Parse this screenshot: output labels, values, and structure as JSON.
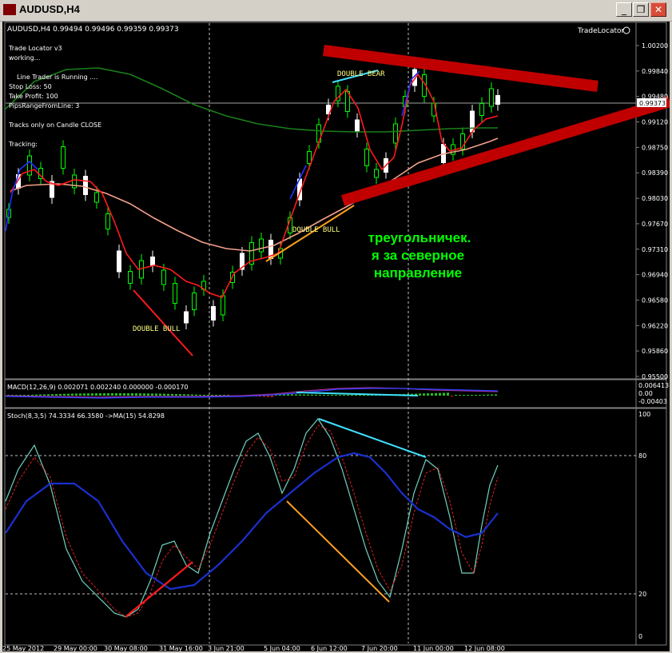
{
  "window": {
    "title": "AUDUSD,H4",
    "minimize": "_",
    "restore": "❐",
    "close": "✕"
  },
  "main_panel": {
    "header": "AUDUSD,H4  0.99494 0.99496 0.99359 0.99373",
    "trade_locator_label": "TradeLocator",
    "ea_info": [
      "Trade Locator v3",
      "working...",
      "",
      "Line Trader is Running ....",
      "Stop Loss: 50",
      "Take Profit: 100",
      "PipsRangeFromLine: 3",
      "",
      "Tracks only on Candle CLOSE",
      "",
      "Tracking:"
    ],
    "price_labels": [
      "1.00200",
      "0.99840",
      "0.99480",
      "0.99120",
      "0.98750",
      "0.98390",
      "0.98030",
      "0.97670",
      "0.97310",
      "0.96940",
      "0.96580",
      "0.96220",
      "0.95860",
      "0.95500"
    ],
    "current_price": "0.99373",
    "pattern_labels": {
      "double_bull_left": "DOUBLE BULL",
      "double_bull_mid": "DOUBLE BULL",
      "double_bear": "DOUBLE BEAR"
    },
    "annotation": [
      "треугольничек.",
      "я за северное",
      "направление"
    ],
    "colors": {
      "bull": "#00ff00",
      "bear": "#ffffff",
      "ma_fast": "#ff0000",
      "ma_slow": "#ffa07a",
      "ma_long": "#008000",
      "triangle": "#cc0000",
      "annotation": "#00ff00",
      "pattern_text": "#ffff80"
    }
  },
  "macd_panel": {
    "header": "MACD(12,26,9) 0.002071 0.002240 0.000000 -0.000170",
    "scale": [
      "0.006413",
      "0.00",
      "-0.00403"
    ]
  },
  "stoch_panel": {
    "header": "Stoch(8,3,5) 74.3334 66.3580  ->MA(15) 54.8298",
    "scale": [
      "100",
      "80",
      "20",
      "0"
    ]
  },
  "time_axis": [
    "25 May 2012",
    "29 May 00:00",
    "30 May 08:00",
    "31 May 16:00",
    "3 Jun 21:00",
    "5 Jun 04:00",
    "6 Jun 12:00",
    "7 Jun 20:00",
    "11 Jun 00:00",
    "12 Jun 08:00"
  ]
}
